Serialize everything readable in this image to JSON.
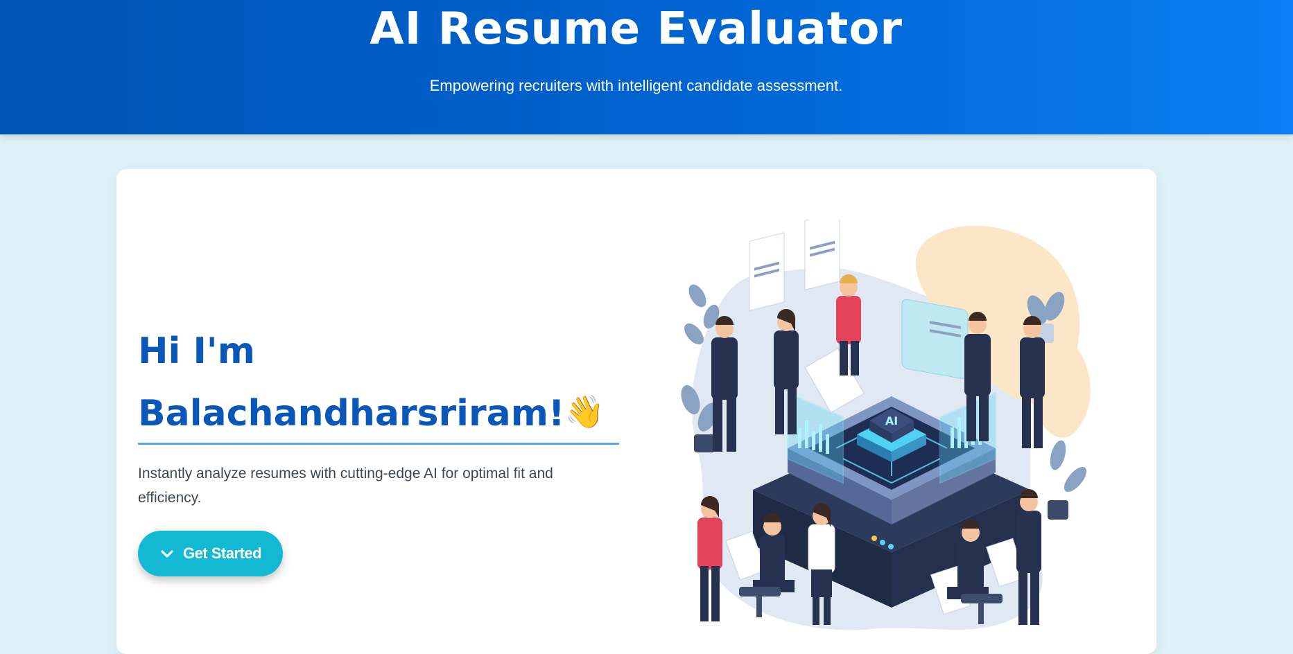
{
  "header": {
    "title": "AI Resume Evaluator",
    "subtitle": "Empowering recruiters with intelligent candidate assessment."
  },
  "hero": {
    "greeting_line1": "Hi I'm",
    "greeting_line2": "Balachandharsriram!",
    "wave_emoji": "👋",
    "description": "Instantly analyze resumes with cutting-edge AI for optimal fit and efficiency.",
    "cta_label": "Get Started",
    "cta_icon": "chevron-down-icon",
    "illustration_chip_label": "AI"
  },
  "colors": {
    "header_start": "#0053b3",
    "header_end": "#0a7ef5",
    "page_bg": "#dff2f7",
    "heading": "#0b57b8",
    "divider": "#5aa6ea",
    "cta": "#13b8d3"
  }
}
